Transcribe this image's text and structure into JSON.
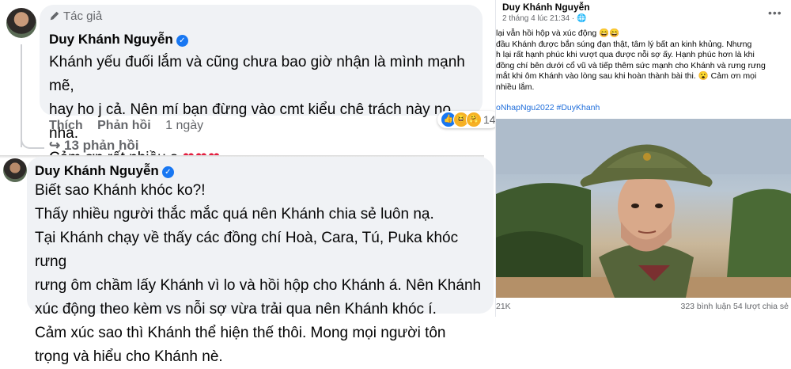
{
  "comment1": {
    "author_tag": "Tác giả",
    "author": "Duy Khánh Nguyễn",
    "text": "Khánh yếu đuối lắm và cũng chưa bao giờ nhận là mình mạnh mẽ,\nhay ho j cả. Nên mí bạn đừng vào cmt kiểu chê trách này nọ nha.\nCảm ơn rất nhiều ạ",
    "hearts": "❤❤❤",
    "like_label": "Thích",
    "reply_label": "Phản hồi",
    "time": "1 ngày",
    "reaction_count": "14",
    "replies_label": "13 phản hồi"
  },
  "comment2": {
    "author": "Duy Khánh Nguyễn",
    "text": "Biết sao Khánh khóc ko?!\nThấy nhiều người thắc mắc quá nên Khánh chia sẻ luôn nạ.\nTại Khánh chạy về thấy các đồng chí Hoà, Cara, Tú, Puka khóc rưng\nrưng ôm chầm lấy Khánh vì lo và hồi hộp cho Khánh á. Nên Khánh\nxúc động theo kèm vs nỗi sợ vừa trải qua nên Khánh khóc í.\nCảm xúc sao thì Khánh thể hiện thế thôi. Mong mọi người tôn\ntrọng và hiểu cho Khánh nè."
  },
  "post": {
    "author": "Duy Khánh Nguyễn",
    "meta": "2 tháng 4 lúc 21:34 ·",
    "text": "lại vẫn hồi hộp và xúc động 😄😄\nđầu Khánh được bắn súng đạn thật, tâm lý bất an kinh khủng. Nhưng\nh lại rất hạnh phúc khi vượt qua được nỗi sợ ấy. Hạnh phúc hơn là khi\nđồng chí bên dưới cổ vũ và tiếp thêm sức mạnh cho Khánh và rưng rưng\n mắt khi ôm Khánh vào lòng sau khi hoàn thành bài thi. 😮 Cảm ơn mọi\nnhiều lắm.",
    "tags": "oNhapNgu2022 #DuyKhanh",
    "likes": "21K",
    "comments_shares": "323 bình luận  54 lượt chia sẻ"
  },
  "colors": {
    "bubble": "#f0f2f5",
    "verified": "#1877f2",
    "heart": "#e41e3f",
    "link": "#216fdb",
    "muted": "#65676b"
  },
  "icons": [
    "pen-icon",
    "verified-badge-icon",
    "heart-icon",
    "like-reaction-icon",
    "haha-reaction-icon",
    "care-reaction-icon",
    "reply-arrow-icon",
    "globe-icon",
    "more-dots-icon"
  ]
}
